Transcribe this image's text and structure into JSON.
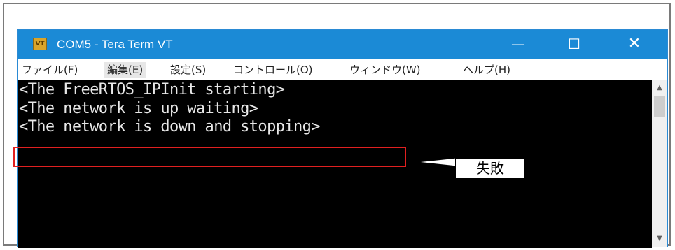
{
  "window": {
    "title": "COM5 - Tera Term VT",
    "app_icon_text": "VT",
    "controls": {
      "minimize": "—",
      "maximize": "☐",
      "close": "✕"
    }
  },
  "menu": {
    "items": [
      {
        "label": "ファイル(F)"
      },
      {
        "label": "編集(E)"
      },
      {
        "label": "設定(S)"
      },
      {
        "label": "コントロール(O)"
      },
      {
        "label": "ウィンドウ(W)"
      },
      {
        "label": "ヘルプ(H)"
      }
    ]
  },
  "terminal": {
    "lines": [
      "<The FreeRTOS_IPInit starting>",
      "<The network is up waiting>",
      "<The network is down and stopping>"
    ],
    "background_color": "#000000",
    "text_color": "#e8e8e8"
  },
  "annotation": {
    "label": "失敗",
    "highlight_color": "#e02020"
  },
  "scrollbar": {
    "up_arrow": "▲",
    "down_arrow": "▼"
  },
  "colors": {
    "titlebar": "#1b8ad6"
  }
}
